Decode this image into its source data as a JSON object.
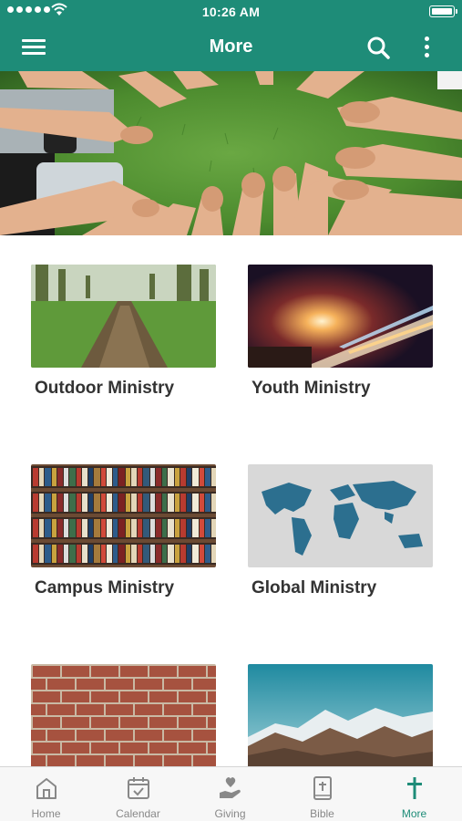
{
  "status_bar": {
    "time": "10:26 AM"
  },
  "app_bar": {
    "title": "More"
  },
  "cards": [
    {
      "label": "Outdoor Ministry"
    },
    {
      "label": "Youth Ministry"
    },
    {
      "label": "Campus Ministry"
    },
    {
      "label": "Global Ministry"
    },
    {
      "label": ""
    },
    {
      "label": ""
    }
  ],
  "tab_bar": {
    "tabs": [
      {
        "label": "Home",
        "icon": "home-icon"
      },
      {
        "label": "Calendar",
        "icon": "calendar-icon"
      },
      {
        "label": "Giving",
        "icon": "giving-hand-icon"
      },
      {
        "label": "Bible",
        "icon": "bible-icon"
      },
      {
        "label": "More",
        "icon": "cross-icon"
      }
    ],
    "active_tab": "More"
  },
  "colors": {
    "primary": "#1e8c78",
    "tab_inactive": "#888888",
    "label_text": "#333333"
  }
}
